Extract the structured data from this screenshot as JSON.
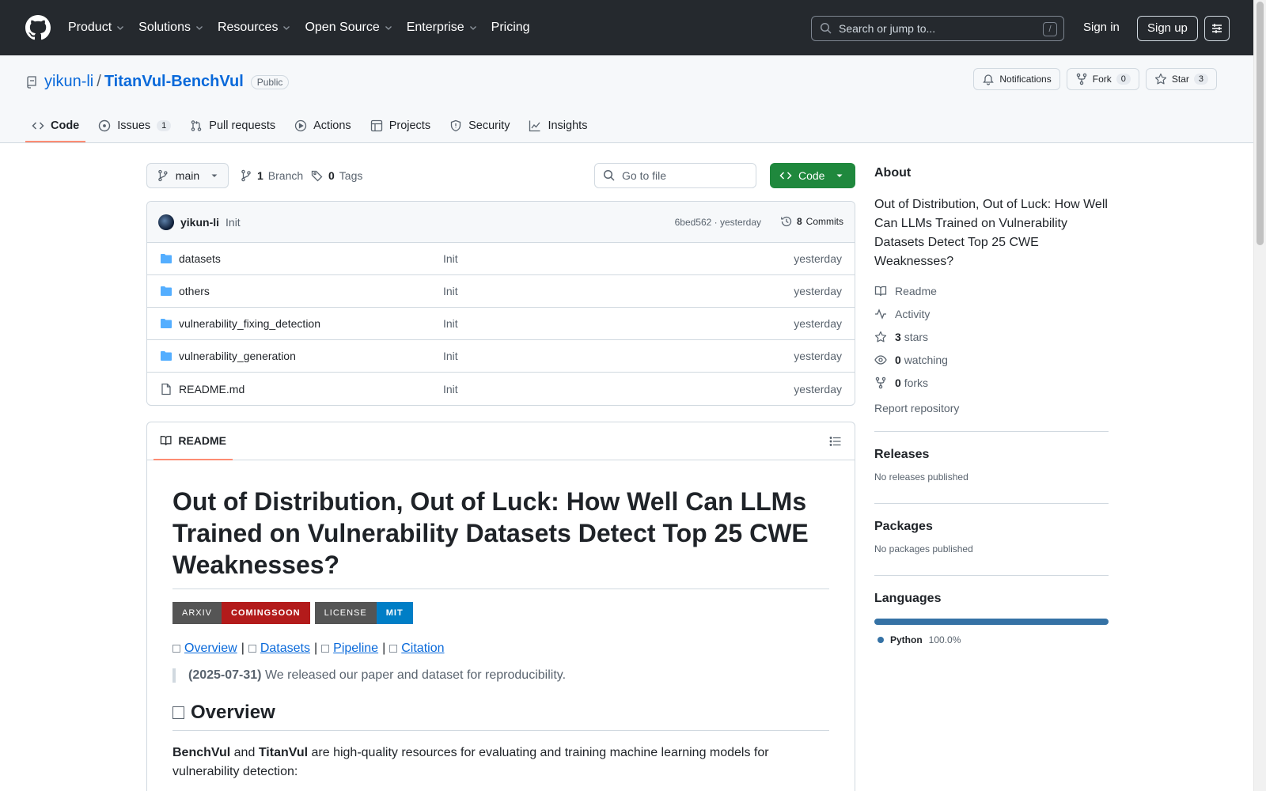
{
  "header": {
    "nav": [
      "Product",
      "Solutions",
      "Resources",
      "Open Source",
      "Enterprise",
      "Pricing"
    ],
    "search_placeholder": "Search or jump to...",
    "search_shortcut": "/",
    "sign_in": "Sign in",
    "sign_up": "Sign up"
  },
  "repo": {
    "owner": "yikun-li",
    "separator": "/",
    "name": "TitanVul-BenchVul",
    "visibility": "Public",
    "notifications_label": "Notifications",
    "fork_label": "Fork",
    "fork_count": "0",
    "star_label": "Star",
    "star_count": "3",
    "tabs": [
      {
        "label": "Code",
        "icon": "code-icon"
      },
      {
        "label": "Issues",
        "icon": "issue-icon",
        "count": "1"
      },
      {
        "label": "Pull requests",
        "icon": "pull-request-icon"
      },
      {
        "label": "Actions",
        "icon": "play-icon"
      },
      {
        "label": "Projects",
        "icon": "table-icon"
      },
      {
        "label": "Security",
        "icon": "shield-icon"
      },
      {
        "label": "Insights",
        "icon": "graph-icon"
      }
    ]
  },
  "toolbar": {
    "branch": "main",
    "branch_count": "1",
    "branch_label": "Branch",
    "tag_count": "0",
    "tag_label": "Tags",
    "go_to_file": "Go to file",
    "code_button": "Code"
  },
  "commit": {
    "author": "yikun-li",
    "message": "Init",
    "hash_time": "6bed562 · yesterday",
    "commits_count": "8",
    "commits_label": "Commits"
  },
  "files": [
    {
      "name": "datasets",
      "type": "folder",
      "message": "Init",
      "date": "yesterday"
    },
    {
      "name": "others",
      "type": "folder",
      "message": "Init",
      "date": "yesterday"
    },
    {
      "name": "vulnerability_fixing_detection",
      "type": "folder",
      "message": "Init",
      "date": "yesterday"
    },
    {
      "name": "vulnerability_generation",
      "type": "folder",
      "message": "Init",
      "date": "yesterday"
    },
    {
      "name": "README.md",
      "type": "file",
      "message": "Init",
      "date": "yesterday"
    }
  ],
  "readme": {
    "tab_label": "README",
    "title": "Out of Distribution, Out of Luck: How Well Can LLMs Trained on Vulnerability Datasets Detect Top 25 CWE Weaknesses?",
    "badges": [
      {
        "left": "ARXIV",
        "right": "COMINGSOON",
        "color": "#b31b1b"
      },
      {
        "left": "LICENSE",
        "right": "MIT",
        "color": "#007ec6"
      }
    ],
    "links": [
      "Overview",
      "Datasets",
      "Pipeline",
      "Citation"
    ],
    "link_separator": "|",
    "news_date": "(2025-07-31)",
    "news_text": "We released our paper and dataset for reproducibility.",
    "overview_heading": "Overview",
    "intro_bold1": "BenchVul",
    "intro_and": "and",
    "intro_bold2": "TitanVul",
    "intro_rest": "are high-quality resources for evaluating and training machine learning models for vulnerability detection:"
  },
  "sidebar": {
    "about_heading": "About",
    "description": "Out of Distribution, Out of Luck: How Well Can LLMs Trained on Vulnerability Datasets Detect Top 25 CWE Weaknesses?",
    "readme": "Readme",
    "activity": "Activity",
    "stars_count": "3",
    "stars_label": "stars",
    "watching_count": "0",
    "watching_label": "watching",
    "forks_count": "0",
    "forks_label": "forks",
    "report": "Report repository",
    "releases_heading": "Releases",
    "releases_text": "No releases published",
    "packages_heading": "Packages",
    "packages_text": "No packages published",
    "languages_heading": "Languages",
    "languages": [
      {
        "name": "Python",
        "percent": "100.0%",
        "color": "#3572A5"
      }
    ]
  },
  "colors": {
    "header_bg": "#25292e",
    "link": "#0969da",
    "code_button": "#1f883d",
    "active_tab_underline": "#fd8c73"
  }
}
